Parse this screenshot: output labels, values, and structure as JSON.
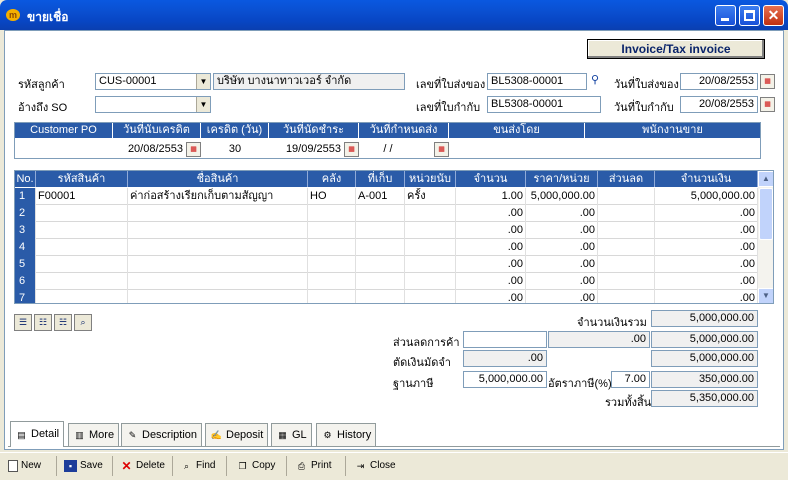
{
  "window": {
    "title": "ขายเชื่อ"
  },
  "header": {
    "invoice_button": "Invoice/Tax invoice",
    "customer_label": "รหัสลูกค้า",
    "customer_code": "CUS-00001",
    "customer_name": "บริษัท บางนาทาวเวอร์ จำกัด",
    "so_label": "อ้างถึง SO",
    "so_value": "",
    "delivery_no_label": "เลขที่ใบส่งของ",
    "delivery_no": "BL5308-00001",
    "delivery_date_label": "วันที่ใบส่งของ",
    "delivery_date": "20/08/2553",
    "tax_no_label": "เลขที่ใบกำกับ",
    "tax_no": "BL5308-00001",
    "tax_date_label": "วันที่ใบกำกับ",
    "tax_date": "20/08/2553"
  },
  "po": {
    "headers": [
      "Customer PO",
      "วันที่นับเครดิต",
      "เครดิต (วัน)",
      "วันที่นัดชำระ",
      "วันที่กำหนดส่ง",
      "ขนส่งโดย",
      "พนักงานขาย"
    ],
    "customer_po": "",
    "credit_start": "20/08/2553",
    "credit_days": "30",
    "due_date": "19/09/2553",
    "ship_date": "/ /",
    "shipped_by": "",
    "salesperson": ""
  },
  "grid": {
    "headers": [
      "No.",
      "รหัสสินค้า",
      "ชื่อสินค้า",
      "คลัง",
      "ที่เก็บ",
      "หน่วยนับ",
      "จำนวน",
      "ราคา/หน่วย",
      "ส่วนลด",
      "จำนวนเงิน"
    ],
    "rows": [
      {
        "no": "1",
        "code": "F00001",
        "name": "ค่าก่อสร้างเรียกเก็บตามสัญญา",
        "wh": "HO",
        "loc": "A-001",
        "unit": "ครั้ง",
        "qty": "1.00",
        "price": "5,000,000.00",
        "disc": "",
        "amount": "5,000,000.00"
      },
      {
        "no": "2",
        "code": "",
        "name": "",
        "wh": "",
        "loc": "",
        "unit": "",
        "qty": ".00",
        "price": ".00",
        "disc": "",
        "amount": ".00"
      },
      {
        "no": "3",
        "code": "",
        "name": "",
        "wh": "",
        "loc": "",
        "unit": "",
        "qty": ".00",
        "price": ".00",
        "disc": "",
        "amount": ".00"
      },
      {
        "no": "4",
        "code": "",
        "name": "",
        "wh": "",
        "loc": "",
        "unit": "",
        "qty": ".00",
        "price": ".00",
        "disc": "",
        "amount": ".00"
      },
      {
        "no": "5",
        "code": "",
        "name": "",
        "wh": "",
        "loc": "",
        "unit": "",
        "qty": ".00",
        "price": ".00",
        "disc": "",
        "amount": ".00"
      },
      {
        "no": "6",
        "code": "",
        "name": "",
        "wh": "",
        "loc": "",
        "unit": "",
        "qty": ".00",
        "price": ".00",
        "disc": "",
        "amount": ".00"
      },
      {
        "no": "7",
        "code": "",
        "name": "",
        "wh": "",
        "loc": "",
        "unit": "",
        "qty": ".00",
        "price": ".00",
        "disc": "",
        "amount": ".00"
      }
    ]
  },
  "totals": {
    "subtotal_label": "จำนวนเงินรวม",
    "subtotal": "5,000,000.00",
    "trade_discount_label": "ส่วนลดการค้า",
    "trade_discount_input": "",
    "trade_discount_pct": ".00",
    "trade_discount_total": "5,000,000.00",
    "deposit_label": "ตัดเงินมัดจำ",
    "deposit": ".00",
    "deposit_total": "5,000,000.00",
    "tax_base_label": "ฐานภาษี",
    "tax_base": "5,000,000.00",
    "vat_rate_label": "อัตราภาษี(%)",
    "vat_rate": "7.00",
    "vat_amount": "350,000.00",
    "grand_total_label": "รวมทั้งสิ้น",
    "grand_total": "5,350,000.00"
  },
  "tabs": [
    "Detail",
    "More",
    "Description",
    "Deposit",
    "GL",
    "History"
  ],
  "toolbar": [
    "New",
    "Save",
    "Delete",
    "Find",
    "Copy",
    "Print",
    "Close"
  ]
}
